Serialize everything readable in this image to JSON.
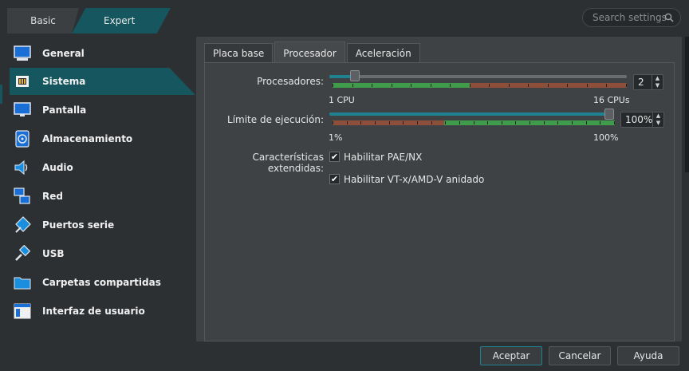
{
  "mode_tabs": {
    "basic": "Basic",
    "expert": "Expert"
  },
  "search": {
    "placeholder": "Search settings"
  },
  "sidebar": {
    "items": [
      {
        "label": "General",
        "icon": "general-icon"
      },
      {
        "label": "Sistema",
        "icon": "system-icon",
        "active": true
      },
      {
        "label": "Pantalla",
        "icon": "display-icon"
      },
      {
        "label": "Almacenamiento",
        "icon": "storage-icon"
      },
      {
        "label": "Audio",
        "icon": "audio-icon"
      },
      {
        "label": "Red",
        "icon": "network-icon"
      },
      {
        "label": "Puertos serie",
        "icon": "serial-ports-icon"
      },
      {
        "label": "USB",
        "icon": "usb-icon"
      },
      {
        "label": "Carpetas compartidas",
        "icon": "shared-folders-icon"
      },
      {
        "label": "Interfaz de usuario",
        "icon": "user-interface-icon"
      }
    ]
  },
  "tabs": {
    "items": [
      {
        "label": "Placa base"
      },
      {
        "label": "Procesador",
        "active": true
      },
      {
        "label": "Aceleración"
      }
    ]
  },
  "processor": {
    "processors_label": "Procesadores:",
    "processors_value": "2",
    "processors_min_label": "1 CPU",
    "processors_max_label": "16 CPUs",
    "processors_level": 2,
    "processors_max": 16,
    "exec_cap_label": "Límite de ejecución:",
    "exec_cap_value": "100%",
    "exec_cap_min_label": "1%",
    "exec_cap_max_label": "100%",
    "exec_cap_level": 100,
    "extended_label": "Características extendidas:",
    "pae_label": "Habilitar PAE/NX",
    "pae_checked": true,
    "vtx_label": "Habilitar VT-x/AMD-V anidado",
    "vtx_checked": true
  },
  "buttons": {
    "accept": "Aceptar",
    "cancel": "Cancelar",
    "help": "Ayuda"
  },
  "colors": {
    "accent": "#16565e",
    "green": "#3f9c4a",
    "red": "#8e4f3a"
  }
}
